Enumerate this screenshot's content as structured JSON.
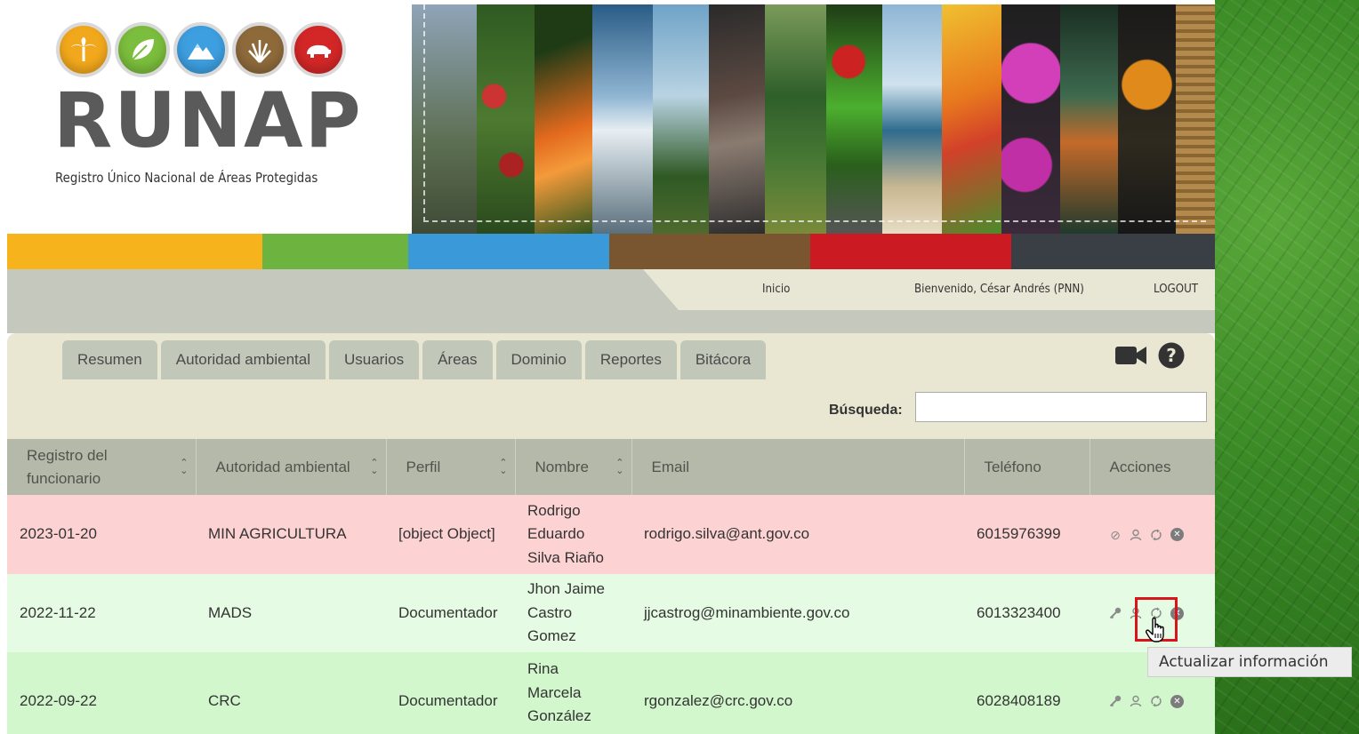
{
  "header": {
    "logo_text": "RUNAP",
    "logo_subtitle": "Registro Único Nacional de Áreas Protegidas",
    "logo_circles": [
      "palm-icon",
      "leaf-icon",
      "mountain-icon",
      "grass-icon",
      "bear-icon"
    ],
    "circle_colors": [
      "#f2a81c",
      "#7bbd3c",
      "#3d9ee0",
      "#8e6a3b",
      "#d32727"
    ],
    "color_bar": [
      "#f6b31b",
      "#6cb33f",
      "#3a9ad9",
      "#7a5630",
      "#cc1a22",
      "#3a3f45"
    ]
  },
  "topnav": {
    "home": "Inicio",
    "welcome": "Bienvenido, César Andrés (PNN)",
    "logout": "LOGOUT"
  },
  "tabs": [
    "Resumen",
    "Autoridad ambiental",
    "Usuarios",
    "Áreas",
    "Dominio",
    "Reportes",
    "Bitácora"
  ],
  "toolbar_icons": [
    "video-camera-icon",
    "help-icon"
  ],
  "search": {
    "label": "Búsqueda:",
    "value": ""
  },
  "table": {
    "headers": [
      "Registro del funcionario",
      "Autoridad ambiental",
      "Perfil",
      "Nombre",
      "Email",
      "Teléfono",
      "Acciones"
    ],
    "rows": [
      {
        "registro": "2023-01-20",
        "autoridad": "MIN AGRICULTURA",
        "perfil": "[object Object]",
        "nombre": [
          "Rodrigo",
          "Eduardo",
          "Silva Riaño"
        ],
        "email": "rodrigo.silva@ant.gov.co",
        "telefono": "6015976399",
        "status": "inactive"
      },
      {
        "registro": "2022-11-22",
        "autoridad": "MADS",
        "perfil": "Documentador",
        "nombre": [
          "Jhon Jaime",
          "Castro",
          "Gomez"
        ],
        "email": "jjcastrog@minambiente.gov.co",
        "telefono": "6013323400",
        "status": "active"
      },
      {
        "registro": "2022-09-22",
        "autoridad": "CRC",
        "perfil": "Documentador",
        "nombre": [
          "Rina",
          "Marcela",
          "González"
        ],
        "email": "rgonzalez@crc.gov.co",
        "telefono": "6028408189",
        "status": "active"
      }
    ]
  },
  "tooltip": "Actualizar información",
  "colors": {
    "row_red": "#fdd2d3",
    "row_green": "#e5fbe3",
    "header_bg": "#b4b9aa",
    "highlight": "#d8141c"
  }
}
